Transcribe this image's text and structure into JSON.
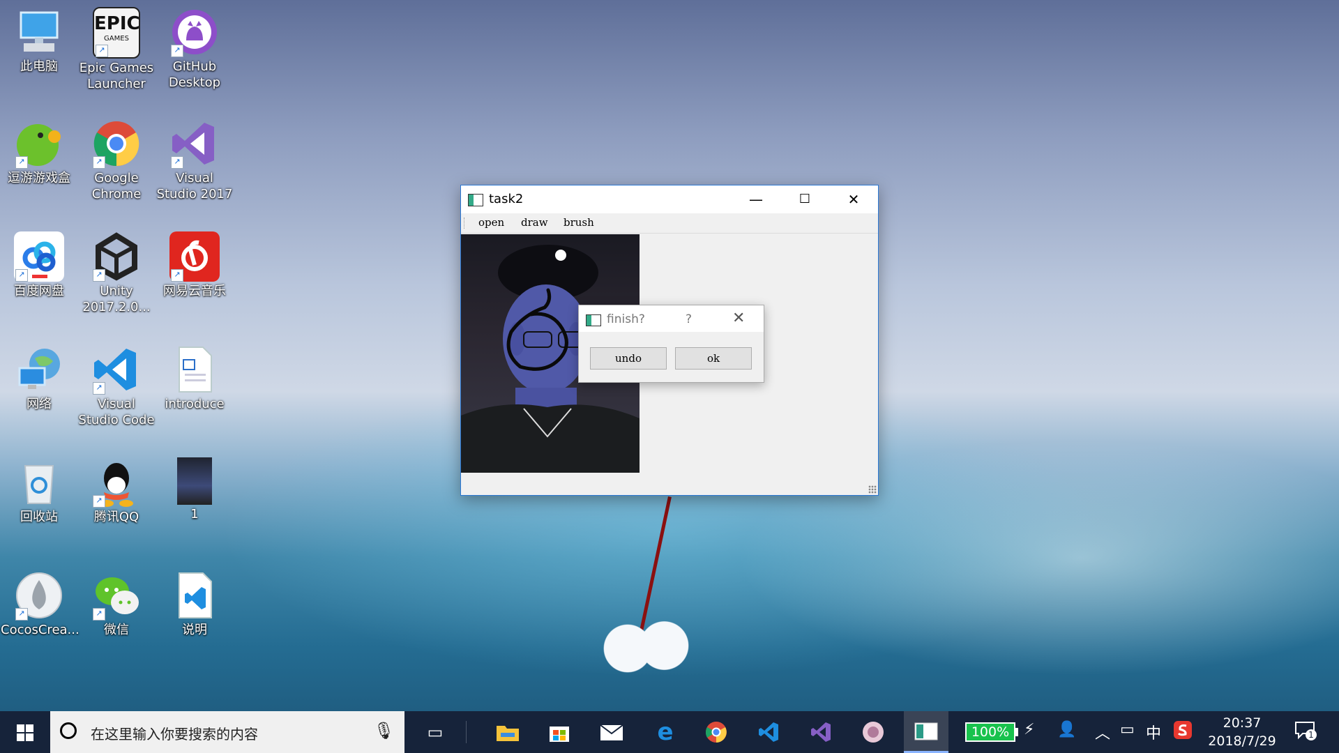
{
  "desktop_icons": [
    {
      "label": "此电脑",
      "icon": "pc-icon"
    },
    {
      "label": "Epic Games Launcher",
      "icon": "epic-games-icon"
    },
    {
      "label": "GitHub Desktop",
      "icon": "github-icon"
    },
    {
      "label": "逗游游戏盒",
      "icon": "game-box-icon"
    },
    {
      "label": "Google Chrome",
      "icon": "chrome-icon"
    },
    {
      "label": "Visual Studio 2017",
      "icon": "visual-studio-icon"
    },
    {
      "label": "百度网盘",
      "icon": "baidu-netdisk-icon"
    },
    {
      "label": "Unity 2017.2.0...",
      "icon": "unity-icon"
    },
    {
      "label": "网易云音乐",
      "icon": "netease-music-icon"
    },
    {
      "label": "网络",
      "icon": "network-icon"
    },
    {
      "label": "Visual Studio Code",
      "icon": "vscode-icon"
    },
    {
      "label": "introduce",
      "icon": "document-icon"
    },
    {
      "label": "回收站",
      "icon": "recycle-bin-icon"
    },
    {
      "label": "腾讯QQ",
      "icon": "qq-icon"
    },
    {
      "label": "1",
      "icon": "photo-thumbnail-icon"
    },
    {
      "label": "CocosCrea...",
      "icon": "cocos-creator-icon"
    },
    {
      "label": "微信",
      "icon": "wechat-icon"
    },
    {
      "label": "说明",
      "icon": "vscode-file-icon"
    }
  ],
  "window": {
    "title": "task2",
    "minimize_glyph": "—",
    "maximize_glyph": "☐",
    "close_glyph": "✕",
    "menu": [
      "open",
      "draw",
      "brush"
    ]
  },
  "dialog": {
    "title": "finish?",
    "help_glyph": "?",
    "close_glyph": "✕",
    "undo_label": "undo",
    "ok_label": "ok"
  },
  "taskbar": {
    "search_placeholder": "在这里输入你要搜索的内容",
    "battery": "100%",
    "ime": "中",
    "time": "20:37",
    "date": "2018/7/29",
    "notification_count": "1",
    "accent_color": "#2b78d4"
  }
}
